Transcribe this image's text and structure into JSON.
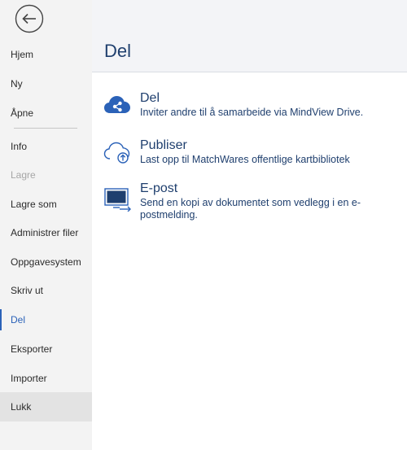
{
  "sidebar": {
    "back_icon": "arrow-left-icon",
    "items": [
      {
        "label": "Hjem",
        "state": "normal"
      },
      {
        "label": "Ny",
        "state": "normal"
      },
      {
        "label": "Åpne",
        "state": "normal"
      },
      {
        "label": "Info",
        "state": "normal"
      },
      {
        "label": "Lagre",
        "state": "disabled"
      },
      {
        "label": "Lagre som",
        "state": "normal"
      },
      {
        "label": "Administrer filer",
        "state": "normal"
      },
      {
        "label": "Oppgavesystem",
        "state": "normal"
      },
      {
        "label": "Skriv ut",
        "state": "normal"
      },
      {
        "label": "Del",
        "state": "active"
      },
      {
        "label": "Eksporter",
        "state": "normal"
      },
      {
        "label": "Importer",
        "state": "normal"
      },
      {
        "label": "Lukk",
        "state": "hover"
      }
    ]
  },
  "main": {
    "title": "Del",
    "options": [
      {
        "title": "Del",
        "description": "Inviter andre til å samarbeide via MindView Drive.",
        "icon": "cloud-share-icon"
      },
      {
        "title": "Publiser",
        "description": "Last opp til MatchWares offentlige kartbibliotek",
        "icon": "cloud-upload-icon"
      },
      {
        "title": "E-post",
        "description": "Send en kopi av dokumentet som vedlegg i en e-postmelding.",
        "icon": "email-monitor-icon"
      }
    ]
  },
  "colors": {
    "accent": "#2b62b8",
    "title": "#1f3f6e",
    "sidebar_bg": "#f3f3f3",
    "header_bg": "#f3f4f7"
  }
}
